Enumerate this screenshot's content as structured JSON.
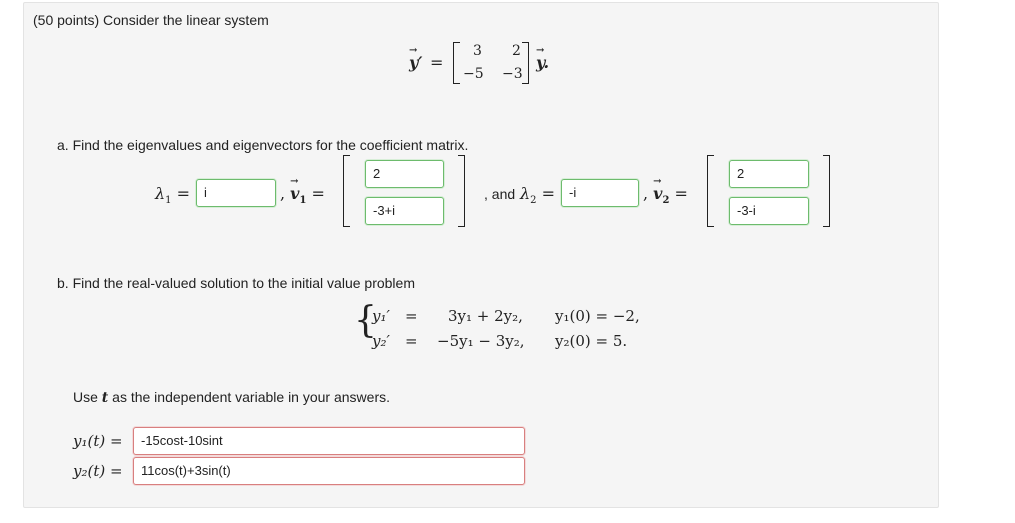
{
  "question": {
    "header": "(50 points) Consider the linear system",
    "system": {
      "lhs": "y′",
      "matrix": [
        [
          "3",
          "2"
        ],
        [
          "−5",
          "−3"
        ]
      ],
      "rhs": "y."
    },
    "part_a": {
      "prompt": "a. Find the eigenvalues and eigenvectors for the coefficient matrix.",
      "lambda1_label": "λ",
      "lambda1_sub": "1",
      "lambda1_value": "i",
      "v1_label": "v",
      "v1_sub": "1",
      "v1_values": [
        "2",
        "-3+i"
      ],
      "and_text": ", and",
      "lambda2_label": "λ",
      "lambda2_sub": "2",
      "lambda2_value": "-i",
      "v2_label": "v",
      "v2_sub": "2",
      "v2_values": [
        "2",
        "-3-i"
      ]
    },
    "part_b": {
      "prompt": "b. Find the real-valued solution to the initial value problem",
      "equations": [
        {
          "lhs": "y₁′",
          "rhs": "3y₁ + 2y₂,",
          "ic": "y₁(0) = −2,"
        },
        {
          "lhs": "y₂′",
          "rhs": "−5y₁ − 3y₂,",
          "ic": "y₂(0) = 5."
        }
      ],
      "instruction_pre": "Use",
      "instruction_var": "t",
      "instruction_post": "as the independent variable in your answers.",
      "answers": [
        {
          "label": "y₁(t) =",
          "value": "-15cost-10sint"
        },
        {
          "label": "y₂(t) =",
          "value": "11cos(t)+3sin(t)"
        }
      ]
    }
  },
  "colors": {
    "correct_border": "#6dbb6d",
    "incorrect_border": "#d87f7f",
    "panel_bg": "#f5f5f5"
  }
}
